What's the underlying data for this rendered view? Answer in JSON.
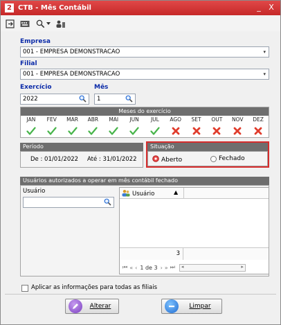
{
  "window": {
    "title": "CTB - Mês Contábil",
    "logo_text": "2",
    "min_symbol": "_",
    "close_symbol": "X"
  },
  "toolbar": {
    "icons": [
      "exit-icon",
      "keyboard-icon",
      "search-icon",
      "dropdown-icon",
      "users-icon"
    ]
  },
  "empresa": {
    "label": "Empresa",
    "value": "001 - EMPRESA DEMONSTRACAO"
  },
  "filial": {
    "label": "Filial",
    "value": "001 - EMPRESA DEMONSTRACAO"
  },
  "exercicio": {
    "label": "Exercício",
    "value": "2022"
  },
  "mes": {
    "label": "Mês",
    "value": "1"
  },
  "meses_exercicio": {
    "header": "Meses do exercício",
    "months": [
      "JAN",
      "FEV",
      "MAR",
      "ABR",
      "MAI",
      "JUN",
      "JUL",
      "AGO",
      "SET",
      "OUT",
      "NOV",
      "DEZ"
    ],
    "status": [
      "check",
      "check",
      "check",
      "check",
      "check",
      "check",
      "check",
      "x",
      "x",
      "x",
      "x",
      "x"
    ]
  },
  "periodo": {
    "header": "Período",
    "de_label": "De :",
    "de_value": "01/01/2022",
    "ate_label": "Até :",
    "ate_value": "31/01/2022"
  },
  "situacao": {
    "header": "Situação",
    "aberto": "Aberto",
    "fechado": "Fechado",
    "selected": "Aberto"
  },
  "usuarios": {
    "header": "Usuários autorizados a operar em mês contábil fechado",
    "usuario_label": "Usuário",
    "usuario_value": "",
    "grid_column": "Usuário",
    "footer_count": "3",
    "pager_text": "1 de 3"
  },
  "aplicar": {
    "label": "Aplicar as informações para todas as filiais",
    "checked": false
  },
  "buttons": {
    "alterar": "Alterar",
    "limpar": "Limpar"
  },
  "colors": {
    "title_red": "#d63333",
    "label_blue": "#0a2aa8",
    "section_gray": "#6e6e6e",
    "check_green": "#47b44a",
    "x_red": "#e03c2c",
    "highlight_red": "#d62c2c"
  }
}
